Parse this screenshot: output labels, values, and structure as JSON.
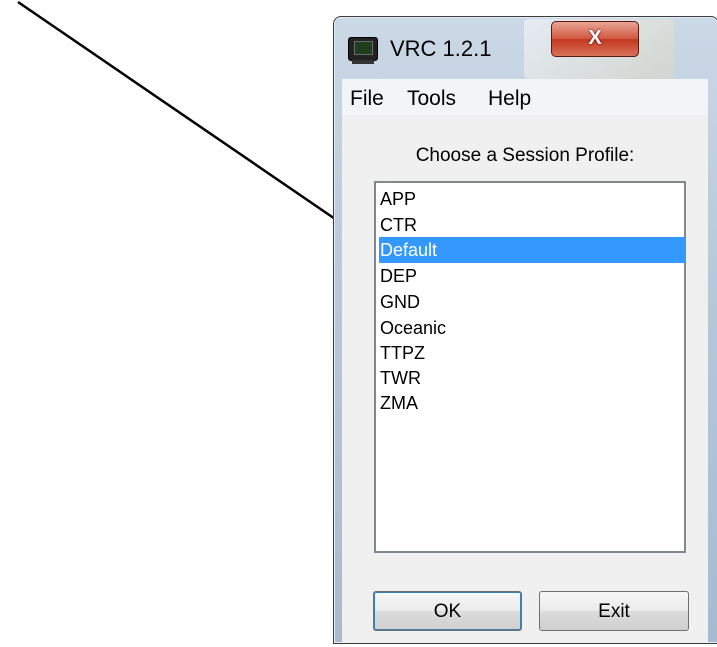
{
  "window": {
    "title": "VRC 1.2.1",
    "close_glyph": "X",
    "icon": "radar-monitor-icon"
  },
  "menu": {
    "items": [
      "File",
      "Tools",
      "Help"
    ]
  },
  "profile_dialog": {
    "prompt": "Choose a Session Profile:",
    "profiles": [
      "APP",
      "CTR",
      "Default",
      "DEP",
      "GND",
      "Oceanic",
      "TTPZ",
      "TWR",
      "ZMA"
    ],
    "selected": "Default",
    "selection_color": "#3399ff"
  },
  "buttons": {
    "ok": "OK",
    "exit": "Exit"
  }
}
